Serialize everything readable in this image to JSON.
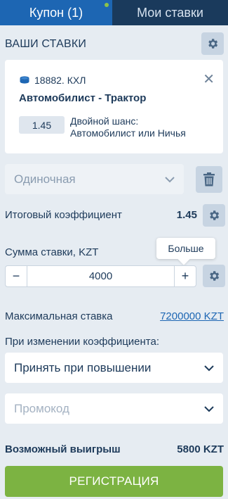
{
  "tabs": [
    {
      "label": "Купон (1)",
      "active": true
    },
    {
      "label": "Мои ставки",
      "active": false
    }
  ],
  "section_title": "ВАШИ СТАВКИ",
  "bet": {
    "event_id": "18882. КХЛ",
    "teams": "Автомобилист - Трактор",
    "odds": "1.45",
    "market_line1": "Двойной шанс:",
    "market_line2": "Автомобилист или Ничья"
  },
  "bet_type": {
    "value": "Одиночная"
  },
  "total_coef": {
    "label": "Итоговый коэффициент",
    "value": "1.45"
  },
  "stake": {
    "label": "Сумма ставки, KZT",
    "value": "4000",
    "minus": "−",
    "plus": "+"
  },
  "tooltip": {
    "text": "Больше"
  },
  "max_stake": {
    "label": "Максимальная ставка",
    "value": "7200000 KZT"
  },
  "odds_change": {
    "label": "При изменении коэффициента:",
    "value": "Принять при повышении"
  },
  "promo": {
    "placeholder": "Промокод"
  },
  "possible_win": {
    "label": "Возможный выигрыш",
    "value": "5800 KZT"
  },
  "register_button": "РЕГИСТРАЦИЯ",
  "colors": {
    "accent": "#1d66b3",
    "nav_dark": "#1a3a5c",
    "success": "#7cb342",
    "dot": "#8bc34a"
  }
}
